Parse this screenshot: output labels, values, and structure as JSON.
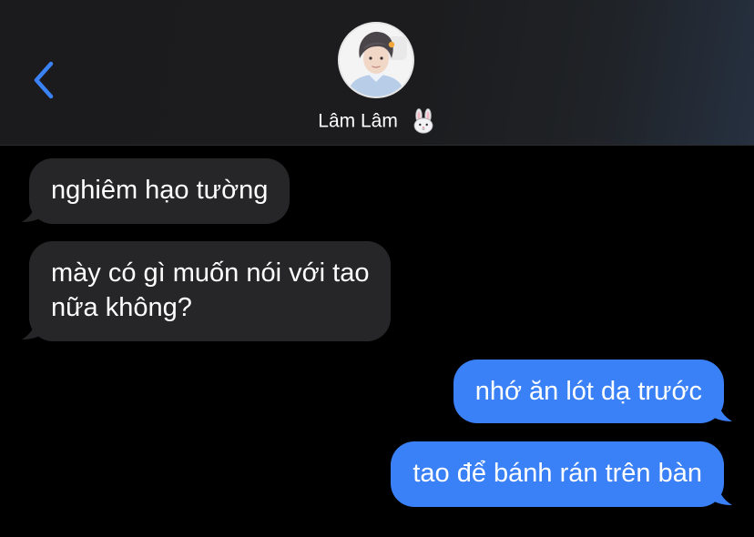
{
  "header": {
    "contact_name": "Lâm Lâm",
    "contact_emoji_icon": "rabbit-face-icon",
    "back_icon": "chevron-left-icon",
    "back_color": "#3a82f6"
  },
  "conversation": {
    "messages": [
      {
        "direction": "received",
        "text": "nghiêm hạo tường"
      },
      {
        "direction": "received",
        "text": "mày có gì muốn nói với tao",
        "text_line2": "nữa không?"
      },
      {
        "direction": "sent",
        "text": "nhớ ăn lót dạ trước"
      },
      {
        "direction": "sent",
        "text": "tao để bánh rán trên bàn"
      }
    ]
  },
  "colors": {
    "background": "#000000",
    "received_bubble": "#262628",
    "sent_bubble": "#3a80f6"
  }
}
